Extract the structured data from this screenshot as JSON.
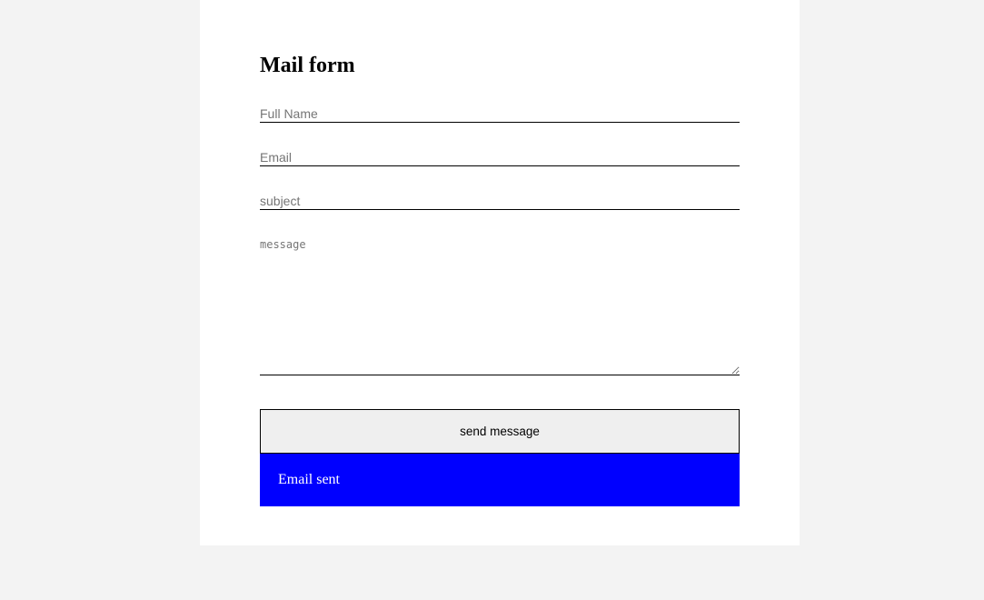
{
  "form": {
    "title": "Mail form",
    "fields": {
      "full_name": {
        "value": "",
        "placeholder": "Full Name"
      },
      "email": {
        "value": "",
        "placeholder": "Email"
      },
      "subject": {
        "value": "",
        "placeholder": "subject"
      },
      "message": {
        "value": "",
        "placeholder": "message"
      }
    },
    "submit_label": "send message",
    "status_message": "Email sent"
  },
  "colors": {
    "page_background": "#f3f3f3",
    "card_background": "#ffffff",
    "button_background": "#efefef",
    "status_background": "#0000ff",
    "status_text": "#ffffff"
  }
}
